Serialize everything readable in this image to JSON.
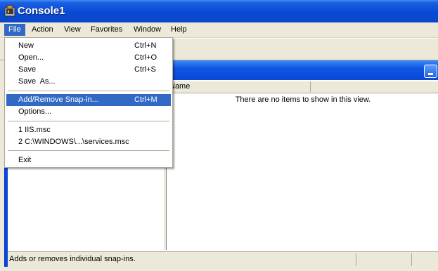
{
  "window": {
    "title": "Console1"
  },
  "menubar": {
    "items": [
      "File",
      "Action",
      "View",
      "Favorites",
      "Window",
      "Help"
    ]
  },
  "file_menu": {
    "new": {
      "label": "New",
      "shortcut": "Ctrl+N"
    },
    "open": {
      "label": "Open...",
      "shortcut": "Ctrl+O"
    },
    "save": {
      "label": "Save",
      "shortcut": "Ctrl+S"
    },
    "save_as": {
      "label": "Save  As..."
    },
    "add_remove": {
      "label": "Add/Remove Snap-in...",
      "shortcut": "Ctrl+M"
    },
    "options": {
      "label": "Options..."
    },
    "recent1": {
      "label": "1 IIS.msc"
    },
    "recent2": {
      "label": "2 C:\\WINDOWS\\...\\services.msc"
    },
    "exit": {
      "label": "Exit"
    }
  },
  "list": {
    "column_name": "Name",
    "empty_message": "There are no items to show in this view."
  },
  "status": {
    "text": "Adds or removes individual snap-ins."
  },
  "colors": {
    "titlebar": "#0a49d6",
    "highlight": "#316ac5",
    "face": "#ece9d8"
  },
  "icons": {
    "app": "mmc-console-icon",
    "minimize": "minimize-icon"
  }
}
